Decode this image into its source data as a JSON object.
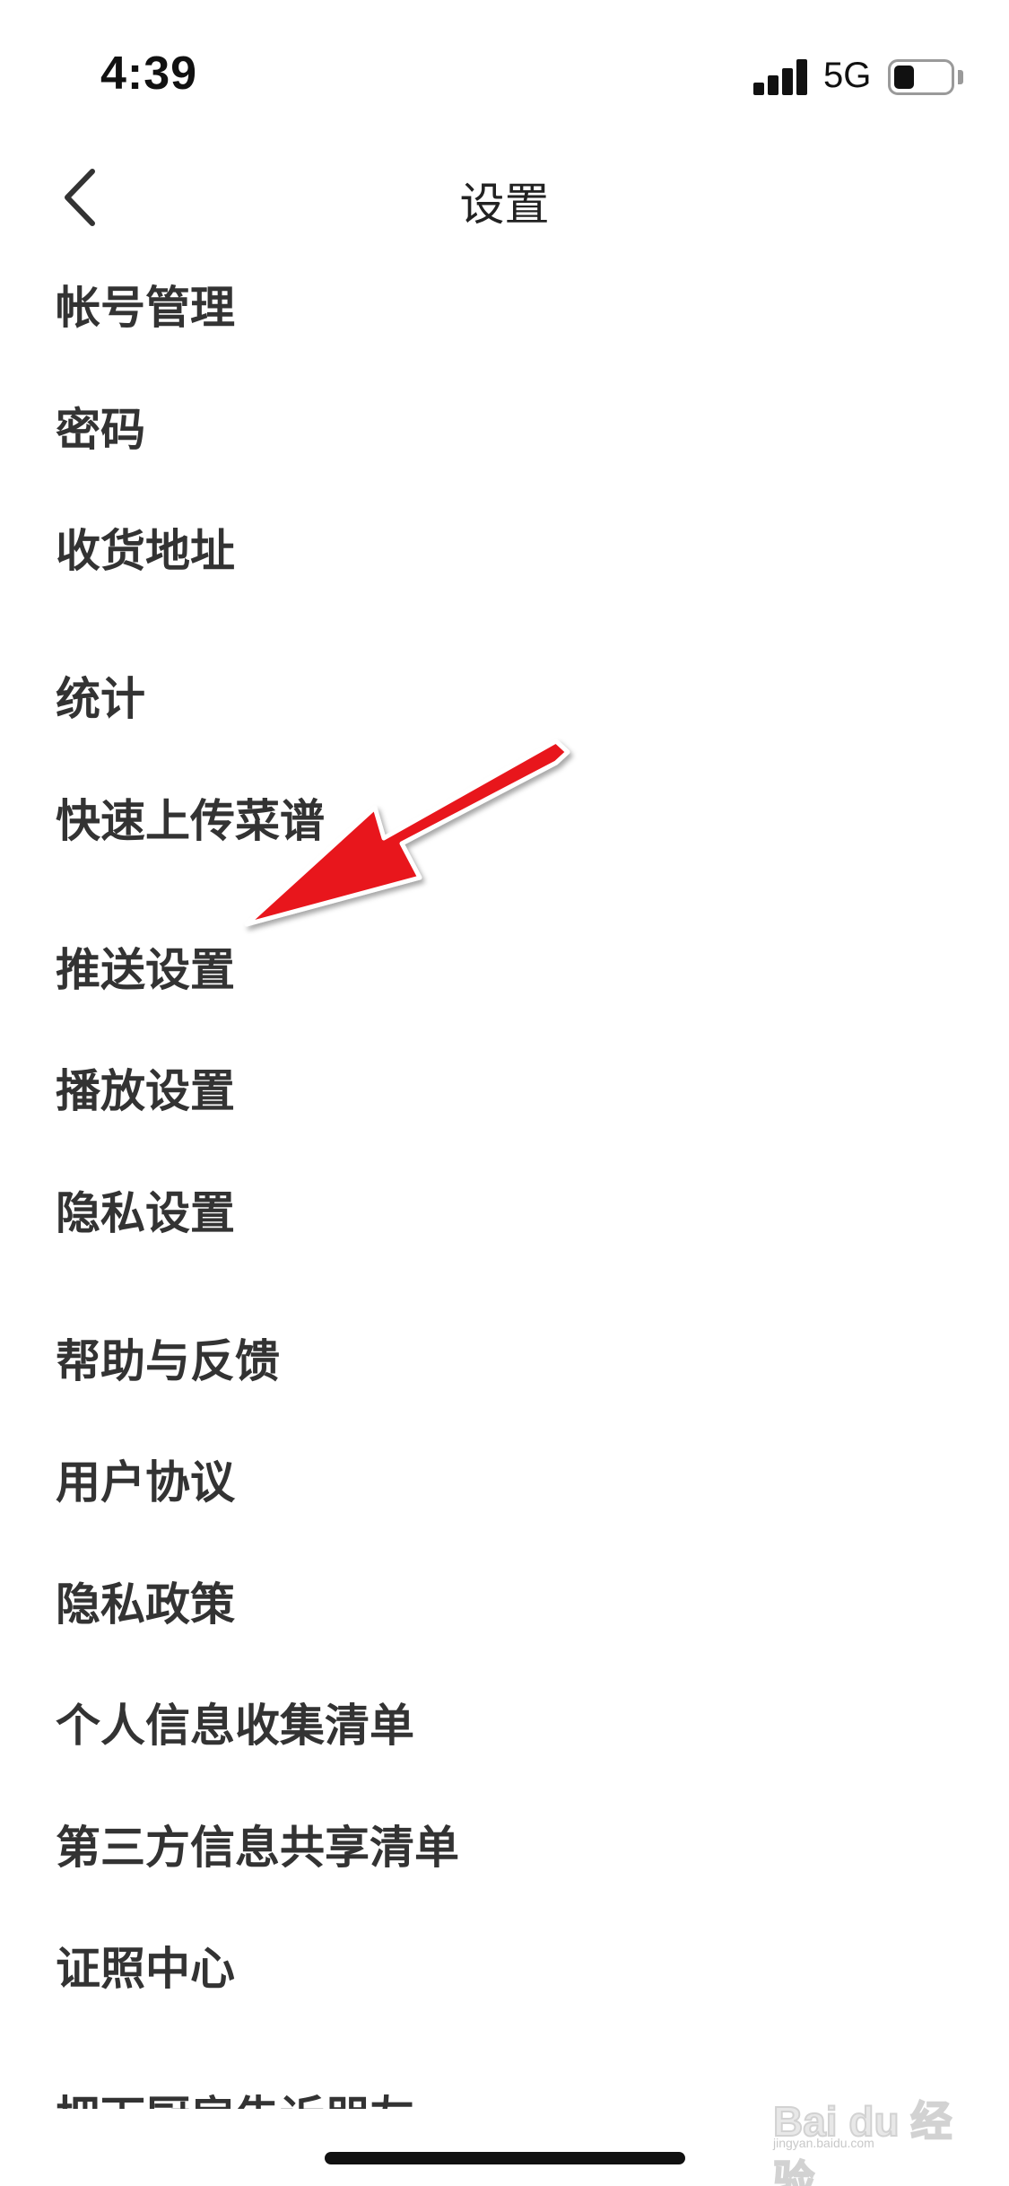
{
  "status_bar": {
    "time": "4:39",
    "network": "5G",
    "battery_level": 0.35
  },
  "nav": {
    "title": "设置",
    "back_icon": "chevron-left-icon"
  },
  "menu": {
    "items": [
      {
        "label": "帐号管理"
      },
      {
        "label": "密码"
      },
      {
        "label": "收货地址"
      },
      {
        "label": "统计"
      },
      {
        "label": "快速上传菜谱"
      },
      {
        "label": "推送设置"
      },
      {
        "label": "播放设置"
      },
      {
        "label": "隐私设置"
      },
      {
        "label": "帮助与反馈"
      },
      {
        "label": "用户协议"
      },
      {
        "label": "隐私政策"
      },
      {
        "label": "个人信息收集清单"
      },
      {
        "label": "第三方信息共享清单"
      },
      {
        "label": "证照中心"
      },
      {
        "label": "把下厨房告诉朋友"
      }
    ]
  },
  "annotation": {
    "color": "#e8141c",
    "target": "推送设置"
  },
  "watermark": {
    "text": "Bai du 经验",
    "sub": "jingyan.baidu.com"
  }
}
